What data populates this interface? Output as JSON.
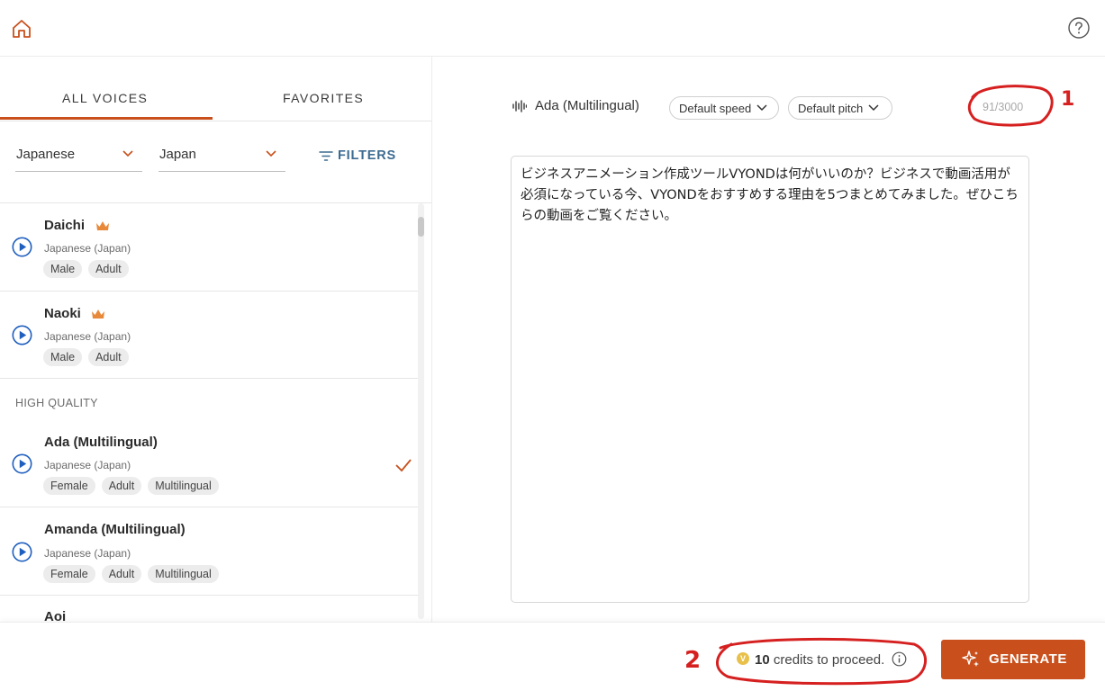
{
  "header": {
    "home_icon": "home-icon",
    "help_icon": "help-circle-icon"
  },
  "tabs": [
    {
      "label": "ALL VOICES",
      "active": true
    },
    {
      "label": "FAVORITES",
      "active": false
    }
  ],
  "filters": {
    "language": "Japanese",
    "country": "Japan",
    "filters_label": "FILTERS"
  },
  "voices": [
    {
      "name": "Daichi",
      "premium": true,
      "language": "Japanese (Japan)",
      "tags": [
        "Male",
        "Adult"
      ],
      "selected": false
    },
    {
      "name": "Naoki",
      "premium": true,
      "language": "Japanese (Japan)",
      "tags": [
        "Male",
        "Adult"
      ],
      "selected": false
    }
  ],
  "section_label": "HIGH QUALITY",
  "hq_voices": [
    {
      "name": "Ada (Multilingual)",
      "language": "Japanese (Japan)",
      "tags": [
        "Female",
        "Adult",
        "Multilingual"
      ],
      "selected": true
    },
    {
      "name": "Amanda (Multilingual)",
      "language": "Japanese (Japan)",
      "tags": [
        "Female",
        "Adult",
        "Multilingual"
      ],
      "selected": false
    },
    {
      "name": "Aoi",
      "language": "",
      "tags": [],
      "selected": false
    }
  ],
  "editor": {
    "voice_name": "Ada (Multilingual)",
    "speed_label": "Default speed",
    "pitch_label": "Default pitch",
    "char_count": "91/3000",
    "text": "ビジネスアニメーション作成ツールVYONDは何がいいのか？ビジネスで動画活用が必須になっている今、VYONDをおすすめする理由を5つまとめてみました。ぜひこちらの動画をご覧ください。"
  },
  "footer": {
    "coin_letter": "V",
    "credits_count": "10",
    "credits_text": "credits to proceed.",
    "generate_label": "GENERATE"
  },
  "annotations": {
    "mark_1": "1",
    "mark_2": "2",
    "color": "#d62020"
  },
  "colors": {
    "accent": "#c9501c",
    "link": "#3c6b91",
    "play": "#1f5fbf",
    "crown": "#e8893a"
  }
}
